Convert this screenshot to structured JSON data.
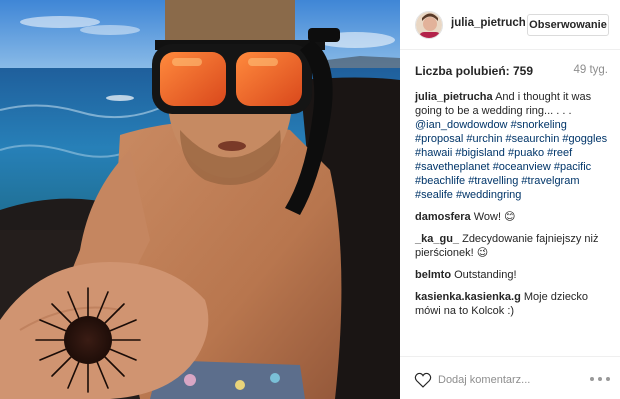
{
  "post": {
    "photo_icon": "snorkeler-with-sea-urchin-photo"
  },
  "header": {
    "username": "julia_pietrucha",
    "avatar_icon": "profile-avatar",
    "follow_label": "Obserwowanie"
  },
  "stats": {
    "likes_label": "Liczba polubień: 759",
    "time_ago": "49 tyg."
  },
  "comments": [
    {
      "user": "julia_pietrucha",
      "text": "And i thought it was going to be a wedding ring... . . .",
      "tags": [
        "@ian_dowdowdow",
        "#snorkeling",
        "#proposal",
        "#urchin",
        "#seaurchin",
        "#goggles",
        "#hawaii",
        "#bigisland",
        "#puako",
        "#reef",
        "#savetheplanet",
        "#oceanview",
        "#pacific",
        "#beachlife",
        "#travelling",
        "#travelgram",
        "#sealife",
        "#weddingring"
      ]
    },
    {
      "user": "damosfera",
      "text": "Wow! 😊"
    },
    {
      "user": "_ka_gu_",
      "text": "Zdecydowanie fajniejszy niż pierścionek! 😉"
    },
    {
      "user": "belmto",
      "text": "Outstanding!"
    },
    {
      "user": "kasienka.kasienka.g",
      "text": "Moje dziecko mówi na to Kolcok :)"
    }
  ],
  "footer": {
    "like_icon": "heart-outline-icon",
    "comment_placeholder": "Dodaj komentarz...",
    "more_icon": "more-options-icon"
  },
  "colors": {
    "username": "#262626",
    "hashtag": "#003569",
    "muted": "#8e8e8e",
    "border": "#dbdbdb"
  }
}
